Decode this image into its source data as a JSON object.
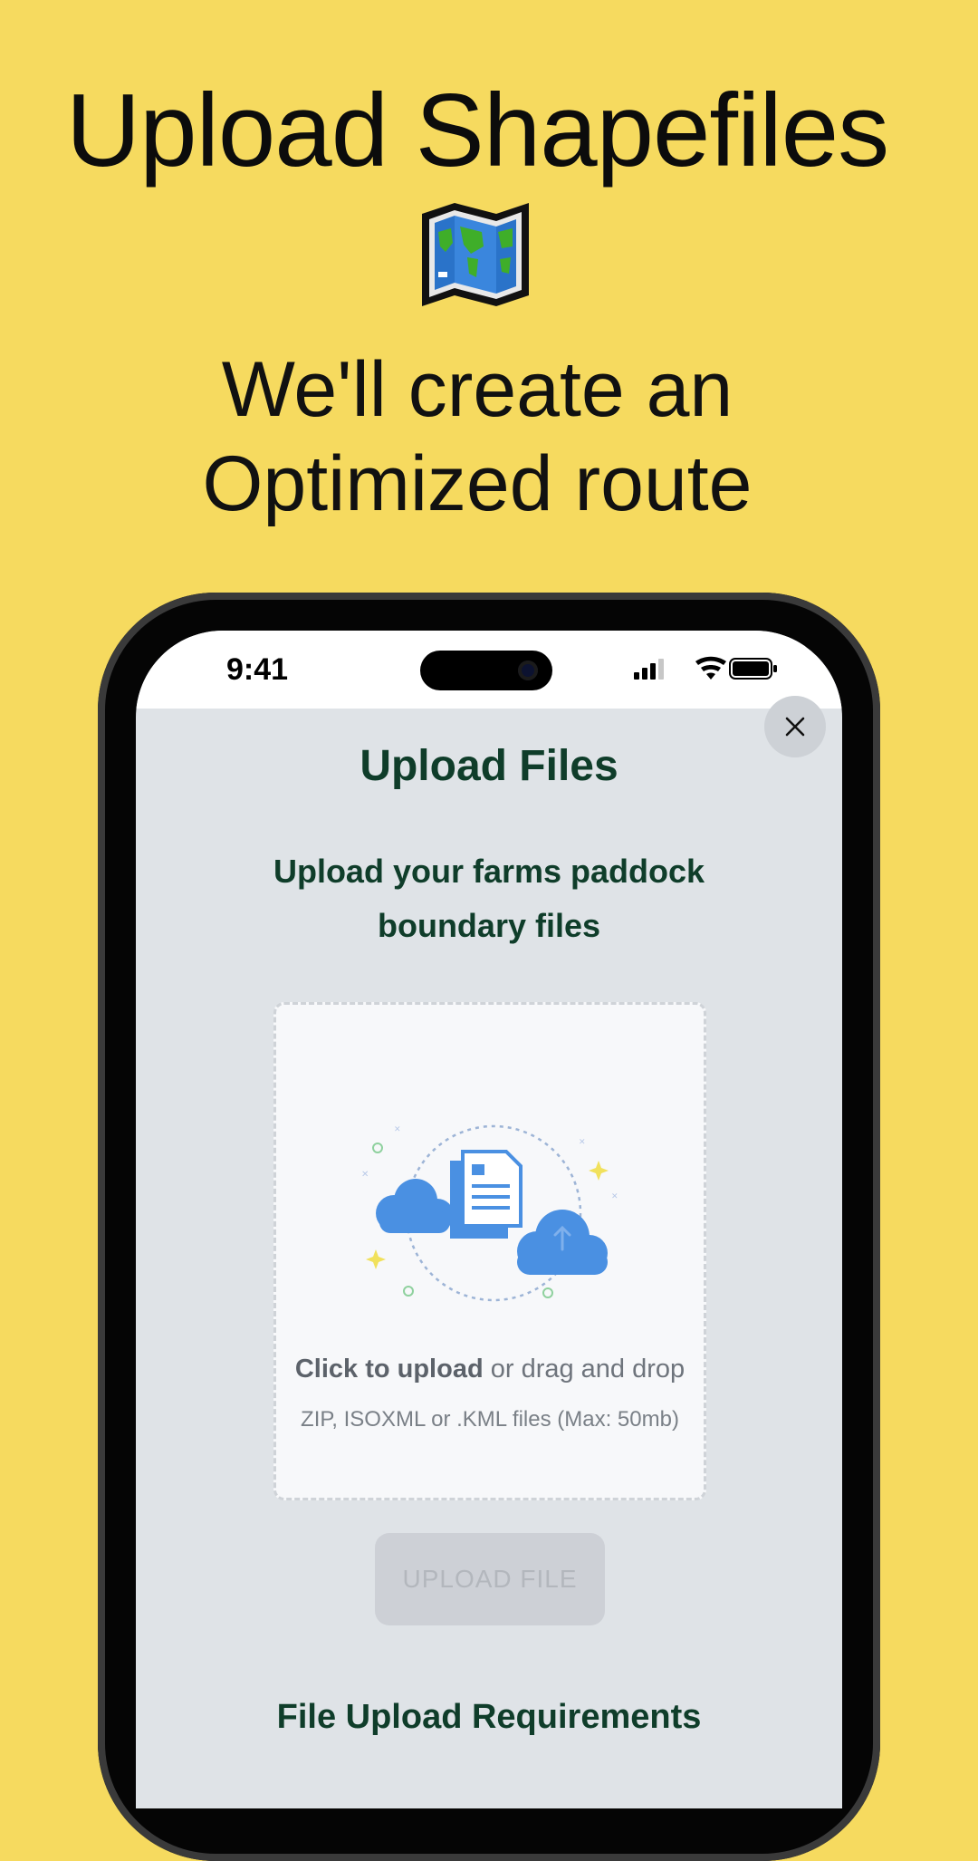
{
  "promo": {
    "headline": "Upload Shapefiles",
    "subline_1": "We'll create an",
    "subline_2": "Optimized route",
    "icon": "world-map-icon"
  },
  "status_bar": {
    "time": "9:41",
    "icons": [
      "signal-icon",
      "wifi-icon",
      "battery-icon"
    ]
  },
  "modal": {
    "title": "Upload Files",
    "subtitle": "Upload your farms paddock boundary files",
    "close_icon": "close-icon",
    "dropzone": {
      "cta_bold": "Click to upload",
      "cta_rest": " or drag and drop",
      "hint": "ZIP, ISOXML or .KML files (Max: 50mb)"
    },
    "upload_button": "UPLOAD FILE",
    "requirements_title": "File Upload Requirements"
  },
  "colors": {
    "background": "#f6da5f",
    "modal_text": "#0f3d2a",
    "illustration_blue": "#4a90e2"
  }
}
